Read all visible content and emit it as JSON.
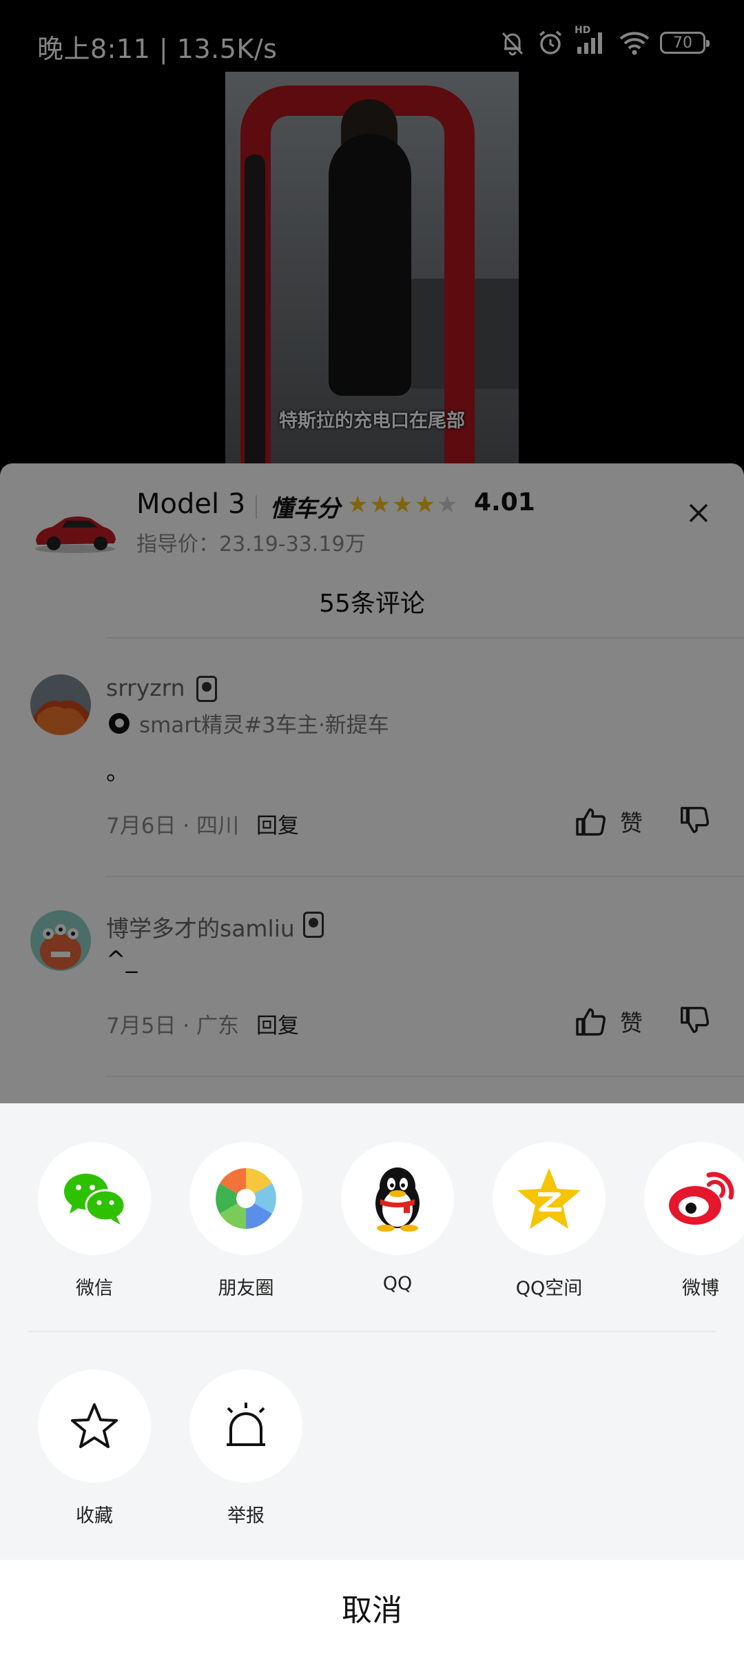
{
  "status_bar": {
    "time": "晚上8:11 | 13.5K/s",
    "battery": "70",
    "network_label": "HD"
  },
  "video": {
    "caption": "特斯拉的充电口在尾部"
  },
  "car_info": {
    "model": "Model 3",
    "brand_logo": "懂车分",
    "rating_stars": 4,
    "rating_score": "4.01",
    "price": "指导价：23.19-33.19万"
  },
  "comments": {
    "count_label": "55条评论",
    "items": [
      {
        "username": "srryzrn",
        "owner_label": "smart精灵#3车主·新提车",
        "text": "。",
        "meta": "7月6日 · 四川",
        "reply_label": "回复",
        "like_label": "赞"
      },
      {
        "username": "博学多才的samliu",
        "text": "^_",
        "meta": "7月5日 · 广东",
        "reply_label": "回复",
        "like_label": "赞"
      }
    ]
  },
  "share_sheet": {
    "targets": [
      {
        "label": "微信",
        "icon": "wechat-icon"
      },
      {
        "label": "朋友圈",
        "icon": "moments-icon"
      },
      {
        "label": "QQ",
        "icon": "qq-icon"
      },
      {
        "label": "QQ空间",
        "icon": "qzone-icon"
      },
      {
        "label": "微博",
        "icon": "weibo-icon"
      }
    ],
    "actions": [
      {
        "label": "收藏",
        "icon": "star-outline-icon"
      },
      {
        "label": "举报",
        "icon": "alarm-icon"
      }
    ],
    "cancel_label": "取消"
  },
  "colors": {
    "wechat_green": "#2dc100",
    "qzone_yellow": "#f7c400",
    "weibo_red": "#e6162d",
    "star_gold": "#f3c11a",
    "sheet_bg": "#f4f5f7"
  }
}
